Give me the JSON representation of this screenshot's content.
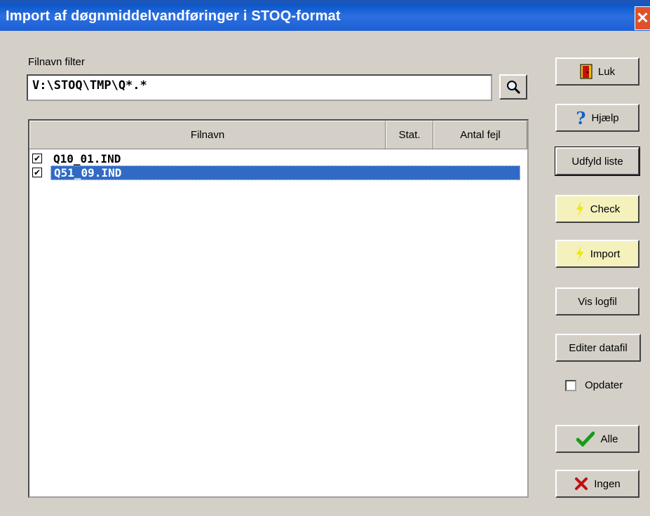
{
  "window": {
    "title": "Import af døgnmiddelvandføringer i STOQ-format",
    "close_glyph": "✕"
  },
  "filter": {
    "label": "Filnavn filter",
    "value": "V:\\STOQ\\TMP\\Q*.*"
  },
  "list": {
    "columns": [
      "Filnavn",
      "Stat.",
      "Antal fejl"
    ],
    "rows": [
      {
        "name": "Q10_01.IND",
        "checked": true,
        "selected": false
      },
      {
        "name": "Q51_09.IND",
        "checked": true,
        "selected": true
      }
    ]
  },
  "buttons": {
    "luk": "Luk",
    "hjaelp": "Hjælp",
    "udfyld": "Udfyld liste",
    "check": "Check",
    "import": "Import",
    "vis_logfil": "Vis logfil",
    "editer": "Editer datafil",
    "alle": "Alle",
    "ingen": "Ingen"
  },
  "opdater": {
    "label": "Opdater",
    "checked": false
  },
  "icons": {
    "luk": "door-icon",
    "hjaelp": "help-icon",
    "check": "lightning-icon",
    "import": "lightning-icon",
    "alle": "checkmark-icon",
    "ingen": "cross-icon",
    "search": "magnifier-icon"
  },
  "colors": {
    "titlebar": "#1d5fd4",
    "selection": "#316ac5",
    "close": "#e0512b",
    "yellow_button": "#f4f1bc"
  }
}
